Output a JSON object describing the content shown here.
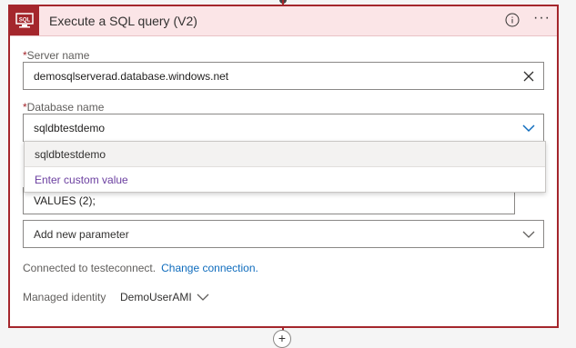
{
  "card": {
    "title": "Execute a SQL query (V2)",
    "icon_text": "SQL"
  },
  "server": {
    "label": "Server name",
    "required_mark": "*",
    "value": "demosqlserverad.database.windows.net"
  },
  "database": {
    "label": "Database name",
    "required_mark": "*",
    "value": "sqldbtestdemo",
    "options": [
      "sqldbtestdemo"
    ],
    "custom_option": "Enter custom value"
  },
  "query": {
    "value": "VALUES (2);"
  },
  "add_parameter": {
    "label": "Add new parameter"
  },
  "connection": {
    "text": "Connected to testeconnect.",
    "link": "Change connection."
  },
  "identity": {
    "label": "Managed identity",
    "value": "DemoUserAMI"
  },
  "colors": {
    "brand": "#a4262c",
    "header_bg": "#fbe5e7",
    "link": "#0f6cbd",
    "custom_option": "#6b3fa0"
  }
}
